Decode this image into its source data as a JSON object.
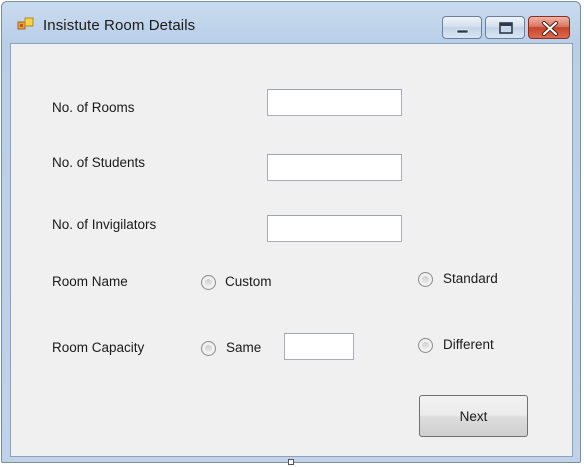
{
  "window": {
    "title": "Insistute Room Details",
    "icon": "app-icon"
  },
  "caption_buttons": {
    "minimize_icon": "minimize-icon",
    "maximize_icon": "maximize-icon",
    "close_icon": "close-icon",
    "close_color": "#c7442b"
  },
  "form": {
    "rooms_label": "No. of Rooms",
    "rooms_value": "",
    "students_label": "No. of Students",
    "students_value": "",
    "invigilators_label": "No. of Invigilators",
    "invigilators_value": "",
    "room_name": {
      "label": "Room Name",
      "option_custom": "Custom",
      "option_standard": "Standard"
    },
    "room_capacity": {
      "label": "Room Capacity",
      "option_same": "Same",
      "same_value": "",
      "option_different": "Different"
    },
    "next_label": "Next"
  }
}
